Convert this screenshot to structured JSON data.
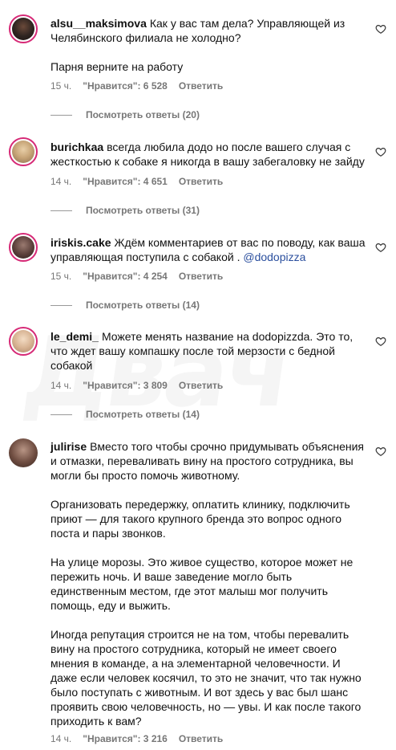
{
  "colors": {
    "accent_ring": "#d62976",
    "mention": "#2b4f9e",
    "meta": "#777777"
  },
  "comments": [
    {
      "username": "alsu__maksimova",
      "text": "Как у вас там дела? Управляющей из\nЧелябинского филиала не холодно?\n\nПарня верните на работу",
      "time": "15 ч.",
      "likes": "\"Нравится\": 6 528",
      "reply": "Ответить",
      "view_replies": "Посмотреть ответы (20)"
    },
    {
      "username": "burichkaa",
      "text": "всегда любила додо но после вашего случая с\nжесткостью к собаке я никогда в вашу забегаловку не зайду",
      "time": "14 ч.",
      "likes": "\"Нравится\": 4 651",
      "reply": "Ответить",
      "view_replies": "Посмотреть ответы (31)"
    },
    {
      "username": "iriskis.cake",
      "text": "Ждём комментариев от вас по поводу, как ваша\nуправляющая поступила с собакой . ",
      "mention": "@dodopizza",
      "time": "15 ч.",
      "likes": "\"Нравится\": 4 254",
      "reply": "Ответить",
      "view_replies": "Посмотреть ответы (14)"
    },
    {
      "username": "le_demi_",
      "text": "Можете менять название на dodopizzda. Это то,\nчто ждет вашу компашку после той мерзости с бедной\nсобакой",
      "time": "14 ч.",
      "likes": "\"Нравится\": 3 809",
      "reply": "Ответить",
      "view_replies": "Посмотреть ответы (14)"
    },
    {
      "username": "julirise",
      "text": "Вместо того чтобы срочно придумывать объяснения\nи отмазки, переваливать вину на простого сотрудника, вы\nмогли бы просто помочь животному.\n\nОрганизовать передержку, оплатить клинику, подключить\nприют — для такого крупного бренда это вопрос одного\nпоста и пары звонков.\n\nНа улице морозы. Это живое существо, которое может не\nпережить ночь. И ваше заведение могло быть\nединственным местом, где этот малыш мог получить\nпомощь, еду и выжить.\n\nИногда репутация строится не на том, чтобы перевалить\nвину на простого сотрудника, который не имеет своего\nмнения в команде, а на элементарной человечности. И\nдаже если человек косячил, то это не значит, что так нужно\nбыло поступать с животным. И вот здесь у вас был шанс\nпроявить свою человечность, но — увы. И как после такого\nприходить к вам?",
      "time": "14 ч.",
      "likes": "\"Нравится\": 3 216",
      "reply": "Ответить"
    }
  ]
}
